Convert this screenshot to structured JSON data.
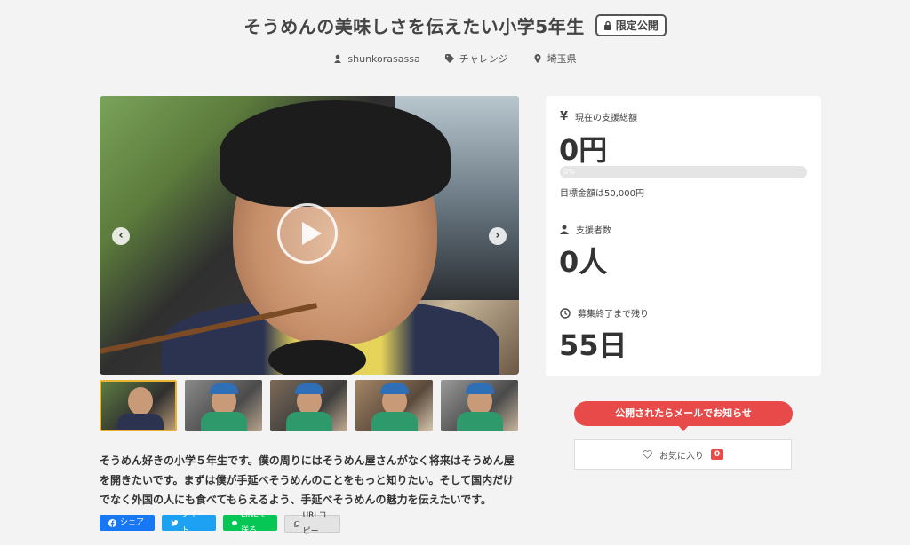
{
  "project": {
    "title": "そうめんの美味しさを伝えたい小学5年生",
    "badge": "限定公開"
  },
  "meta": {
    "author": "shunkorasassa",
    "category": "チャレンジ",
    "location": "埼玉県"
  },
  "gallery": {
    "thumbnail_count": 5,
    "active_index": 0
  },
  "description": "そうめん好きの小学５年生です。僕の周りにはそうめん屋さんがなく将来はそうめん屋を開きたいです。まずは僕が手延べそうめんのことをもっと知りたい。そして国内だけでなく外国の人にも食べてもらえるよう、手延べそうめんの魅力を伝えたいです。",
  "share": {
    "facebook": "シェア",
    "twitter": "ツイート",
    "line": "LINEで送る",
    "url_copy": "URLコピー"
  },
  "stats": {
    "total_label": "現在の支援総額",
    "total_value": "0円",
    "progress_percent": 0,
    "progress_text": "0%",
    "goal_text": "目標金額は50,000円",
    "supporters_label": "支援者数",
    "supporters_value": "0人",
    "remaining_label": "募集終了まで残り",
    "remaining_value": "55日"
  },
  "actions": {
    "notify_label": "公開されたらメールでお知らせ",
    "favorite_label": "お気に入り",
    "favorite_count": "0"
  },
  "colors": {
    "accent_red": "#e84a4a",
    "facebook": "#1877f2",
    "twitter": "#1da1f2",
    "line": "#06c755"
  }
}
